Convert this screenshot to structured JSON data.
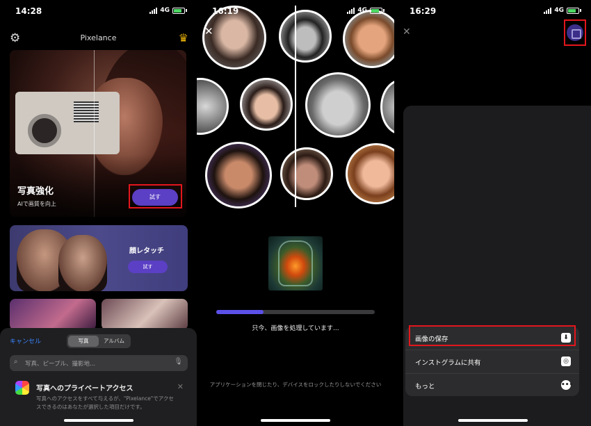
{
  "phone1": {
    "status": {
      "time": "14:28",
      "network": "4G"
    },
    "header": {
      "title": "Pixelance"
    },
    "hero": {
      "title": "写真強化",
      "subtitle": "AIで画質を向上",
      "button": "試す"
    },
    "card2": {
      "title": "顔レタッチ",
      "button": "試す"
    },
    "sheet": {
      "cancel": "キャンセル",
      "tabs": [
        {
          "label": "写真",
          "active": true
        },
        {
          "label": "アルバム",
          "active": false
        }
      ],
      "search_placeholder": "写真、ピープル、撮影地...",
      "access_title": "写真へのプライベートアクセス",
      "access_body": "写真へのアクセスをすべて与えるが、\"Pixelance\"でアクセスできるのはあなたが選択した項目だけです。"
    }
  },
  "phone2": {
    "status": {
      "time": "16:19",
      "network": "4G"
    },
    "progress": 0.3,
    "processing_text": "只今、画像を処理しています...",
    "warning": "アプリケーションを閉じたり、デバイスをロックしたりしないでください"
  },
  "phone3": {
    "status": {
      "time": "16:29",
      "network": "4G"
    },
    "menu": [
      {
        "label": "画像の保存",
        "icon": "download-icon"
      },
      {
        "label": "インストグラムに共有",
        "icon": "instagram-icon"
      },
      {
        "label": "もっと",
        "icon": "more-icon"
      }
    ]
  },
  "colors": {
    "accent": "#5b3fc4",
    "highlight": "#e3161c",
    "link": "#3a84ff"
  }
}
